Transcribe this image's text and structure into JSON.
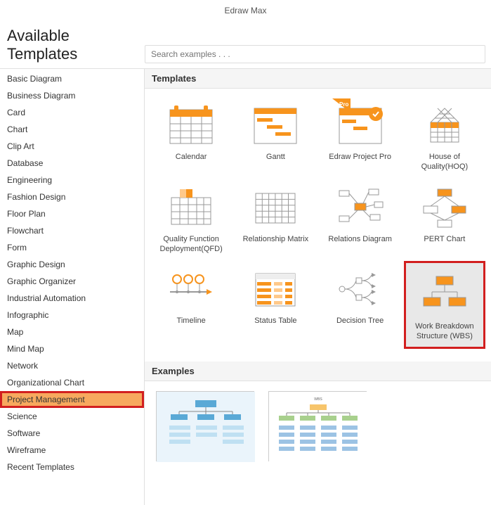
{
  "app_title": "Edraw Max",
  "page_title": "Available Templates",
  "search_placeholder": "Search examples . . .",
  "sidebar": {
    "items": [
      {
        "label": "Basic Diagram"
      },
      {
        "label": "Business Diagram"
      },
      {
        "label": "Card"
      },
      {
        "label": "Chart"
      },
      {
        "label": "Clip Art"
      },
      {
        "label": "Database"
      },
      {
        "label": "Engineering"
      },
      {
        "label": "Fashion Design"
      },
      {
        "label": "Floor Plan"
      },
      {
        "label": "Flowchart"
      },
      {
        "label": "Form"
      },
      {
        "label": "Graphic Design"
      },
      {
        "label": "Graphic Organizer"
      },
      {
        "label": "Industrial Automation"
      },
      {
        "label": "Infographic"
      },
      {
        "label": "Map"
      },
      {
        "label": "Mind Map"
      },
      {
        "label": "Network"
      },
      {
        "label": "Organizational Chart"
      },
      {
        "label": "Project Management"
      },
      {
        "label": "Science"
      },
      {
        "label": "Software"
      },
      {
        "label": "Wireframe"
      },
      {
        "label": "Recent Templates"
      }
    ],
    "selected_index": 19,
    "highlighted_index": 19
  },
  "sections": {
    "templates_header": "Templates",
    "examples_header": "Examples"
  },
  "templates": [
    {
      "label": "Calendar",
      "icon": "calendar"
    },
    {
      "label": "Gantt",
      "icon": "gantt"
    },
    {
      "label": "Edraw Project Pro",
      "icon": "project-pro",
      "badge": "Pro"
    },
    {
      "label": "House of Quality(HOQ)",
      "icon": "hoq"
    },
    {
      "label": "Quality Function Deployment(QFD)",
      "icon": "qfd"
    },
    {
      "label": "Relationship Matrix",
      "icon": "matrix"
    },
    {
      "label": "Relations Diagram",
      "icon": "relations"
    },
    {
      "label": "PERT Chart",
      "icon": "pert"
    },
    {
      "label": "Timeline",
      "icon": "timeline"
    },
    {
      "label": "Status Table",
      "icon": "status-table"
    },
    {
      "label": "Decision Tree",
      "icon": "decision-tree"
    },
    {
      "label": "Work Breakdown Structure (WBS)",
      "icon": "wbs"
    }
  ],
  "highlighted_template_index": 11,
  "examples_count": 2,
  "colors": {
    "accent": "#f7941d",
    "highlight_border": "#d21f1f",
    "selected_bg": "#f7a95e"
  }
}
